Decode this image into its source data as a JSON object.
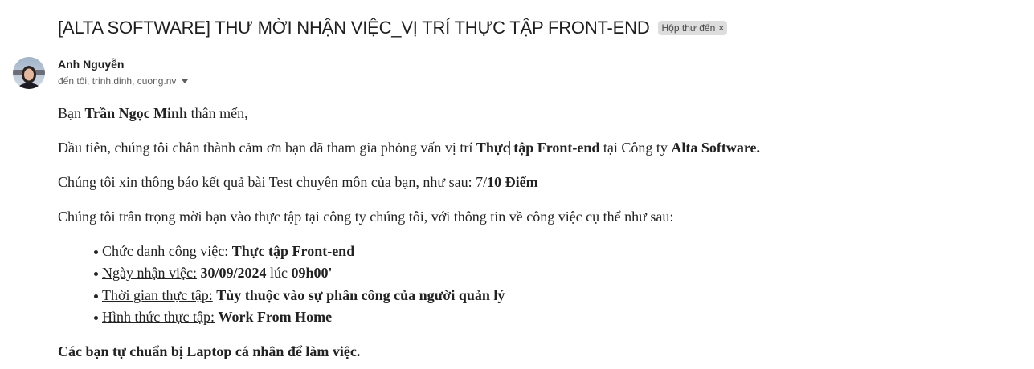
{
  "email": {
    "subject": "[ALTA SOFTWARE] THƯ MỜI NHẬN VIỆC_VỊ TRÍ THỰC TẬP FRONT-END",
    "label_chip": "Hộp thư đến",
    "label_close": "×",
    "sender_name": "Anh Nguyễn",
    "recipients": "đến tôi, trinh.dinh, cuong.nv"
  },
  "body": {
    "greeting": {
      "pre": "Bạn ",
      "name": "Trần Ngọc Minh",
      "post": " thân mến,"
    },
    "para1": {
      "pre": "Đầu tiên, chúng tôi chân thành cảm ơn bạn đã tham gia phỏng vấn vị trí ",
      "role_a": "Thực",
      "role_b": " tập Front-end",
      "mid": " tại Công ty ",
      "company": "Alta Software."
    },
    "para2": {
      "pre": "Chúng tôi xin thông báo kết quả bài Test chuyên môn của bạn, như sau: 7/",
      "score": "10 Điểm"
    },
    "para3": "Chúng tôi trân trọng mời bạn vào thực tập tại công ty chúng tôi, với thông tin về công việc cụ thể như sau:",
    "items": [
      {
        "key": "Chức danh công việc:",
        "value": "Thực tập Front-end"
      },
      {
        "key": "Ngày nhận việc:",
        "value": "30/09/2024",
        "mid": " lúc ",
        "value2": "09h00'"
      },
      {
        "key": "Thời gian thực tập:",
        "value": "Tùy thuộc vào sự phân công của người quản lý"
      },
      {
        "key": "Hình thức thực tập:",
        "value": "Work From Home"
      }
    ],
    "closing": "Các bạn tự chuẩn bị Laptop cá nhân để làm việc."
  },
  "icons": {
    "avatar": "avatar",
    "dropdown": "chevron-down-icon",
    "close": "close-icon"
  }
}
